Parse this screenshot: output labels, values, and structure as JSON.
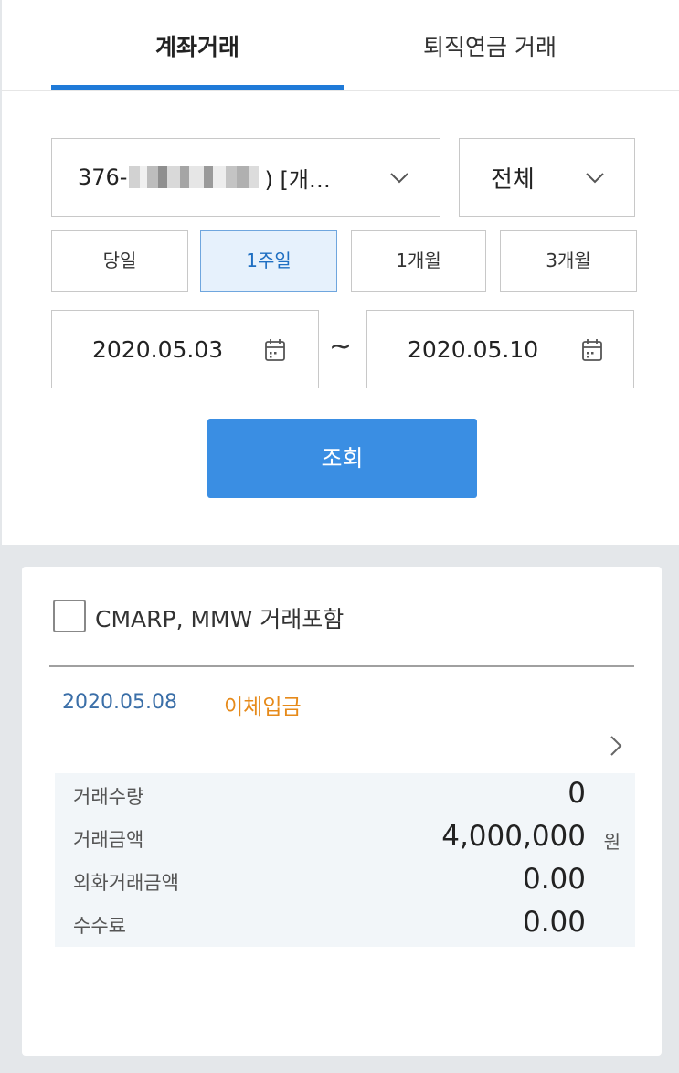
{
  "tabs": [
    {
      "label": "계좌거래",
      "active": true
    },
    {
      "label": "퇴직연금 거래",
      "active": false
    }
  ],
  "account": {
    "prefix": "376-",
    "suffix": ") [개…",
    "icon": "chevron-down-icon"
  },
  "type_filter": {
    "value": "전체",
    "icon": "chevron-down-icon"
  },
  "periods": [
    {
      "label": "당일",
      "active": false
    },
    {
      "label": "1주일",
      "active": true
    },
    {
      "label": "1개월",
      "active": false
    },
    {
      "label": "3개월",
      "active": false
    }
  ],
  "date_range": {
    "start": "2020.05.03",
    "separator": "~",
    "end": "2020.05.10",
    "icon": "calendar-icon"
  },
  "search_button": "조회",
  "include_option": {
    "label": "CMARP, MMW 거래포함",
    "checked": false
  },
  "transaction": {
    "date": "2020.05.08",
    "type": "이체입금",
    "rows": [
      {
        "label": "거래수량",
        "value": "0",
        "unit": ""
      },
      {
        "label": "거래금액",
        "value": "4,000,000",
        "unit": "원"
      },
      {
        "label": "외화거래금액",
        "value": "0.00",
        "unit": ""
      },
      {
        "label": "수수료",
        "value": "0.00",
        "unit": ""
      }
    ]
  },
  "colors": {
    "accent": "#1f7ad8",
    "button": "#3a8ee3",
    "date_text": "#3b6fa8",
    "type_text": "#e68a1a"
  }
}
